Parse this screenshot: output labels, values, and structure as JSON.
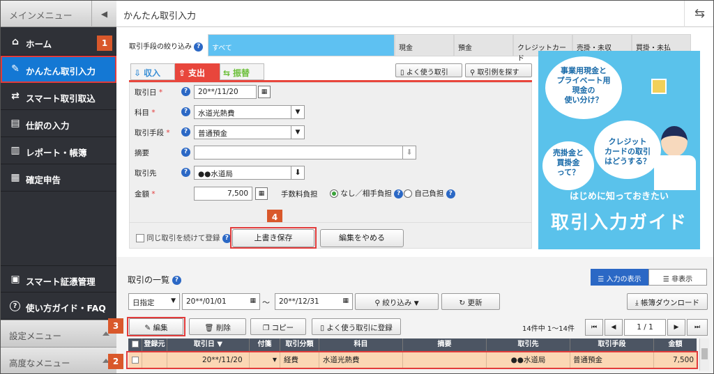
{
  "sidebar": {
    "header": "メインメニュー",
    "items": [
      {
        "label": "ホーム",
        "icon": "home-icon"
      },
      {
        "label": "かんたん取引入力",
        "icon": "pencil-icon"
      },
      {
        "label": "スマート取引取込",
        "icon": "import-icon"
      },
      {
        "label": "仕訳の入力",
        "icon": "journal-icon"
      },
      {
        "label": "レポート・帳簿",
        "icon": "chart-icon"
      },
      {
        "label": "確定申告",
        "icon": "calculator-icon"
      }
    ],
    "bottom": [
      {
        "label": "スマート証憑管理",
        "icon": "document-icon"
      },
      {
        "label": "使い方ガイド・FAQ",
        "icon": "question-icon"
      }
    ],
    "settings": "設定メニュー",
    "advanced": "高度なメニュー"
  },
  "callouts": {
    "c1": "1",
    "c2": "2",
    "c3": "3",
    "c4": "4"
  },
  "title": "かんたん取引入力",
  "filter": {
    "label": "取引手段の絞り込み",
    "tabs": [
      "すべて",
      "現金",
      "預金",
      "クレジットカード",
      "売掛・未収",
      "買掛・未払"
    ]
  },
  "entry_tabs": {
    "income": "収入",
    "expense": "支出",
    "transfer": "振替"
  },
  "top_buttons": {
    "frequent": "よく使う取引",
    "search": "取引例を探す"
  },
  "form": {
    "date_label": "取引日",
    "date_value": "20**/11/20",
    "account_label": "科目",
    "account_value": "水道光熱費",
    "method_label": "取引手段",
    "method_value": "普通預金",
    "memo_label": "摘要",
    "memo_value": "",
    "partner_label": "取引先",
    "partner_value": "●●水道局",
    "amount_label": "金額",
    "amount_value": "7,500",
    "fee_label": "手数料負担",
    "fee_opt1": "なし／相手負担",
    "fee_opt2": "自己負担",
    "required_mark": "*"
  },
  "form_actions": {
    "continue": "同じ取引を続けて登録",
    "save": "上書き保存",
    "cancel": "編集をやめる"
  },
  "ad": {
    "b1": "事業用現金と\nプライベート用\n現金の\n使い分け？",
    "b2": "クレジット\nカードの取引\nはどうする？",
    "b3": "売掛金と\n買掛金\nって？",
    "sub": "はじめに知っておきたい",
    "big": "取引入力ガイド"
  },
  "list": {
    "title": "取引の一覧",
    "view_input": "入力の表示",
    "view_hide": "非表示",
    "period": "日指定",
    "from": "20**/01/01",
    "tilde": "～",
    "to": "20**/12/31",
    "filter": "絞り込み",
    "refresh": "更新",
    "download": "帳簿ダウンロード",
    "edit": "編集",
    "delete": "削除",
    "copy": "コピー",
    "register": "よく使う取引に登録",
    "count": "14件中 1〜14件",
    "page": "1",
    "of": "/",
    "pages": "1",
    "headers": [
      "登録元",
      "取引日",
      "付箋",
      "取引分類",
      "科目",
      "摘要",
      "取引先",
      "取引手段",
      "金額"
    ],
    "row": {
      "date": "20**/11/20",
      "class": "経費",
      "account": "水道光熱費",
      "memo": "",
      "partner": "●●水道局",
      "method": "普通預金",
      "amount": "7,500"
    }
  }
}
